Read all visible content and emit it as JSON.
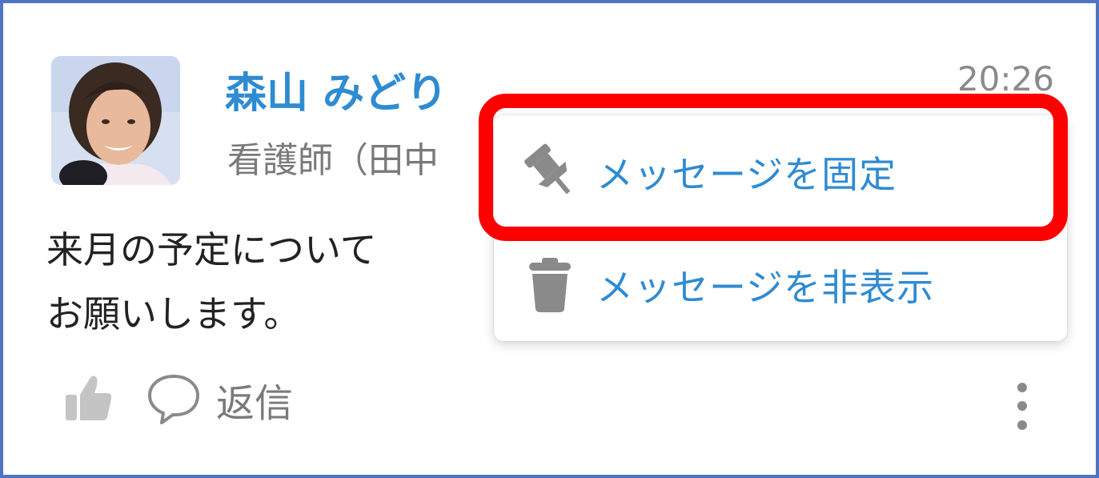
{
  "post": {
    "author_name": "森山 みどり",
    "author_role": "看護師（田中",
    "time": "20:26",
    "message_lines": [
      "来月の予定について",
      "お願いします。"
    ]
  },
  "actions": {
    "like_icon": "thumbs-up-icon",
    "reply_icon": "speech-bubble-icon",
    "reply_label": "返信",
    "more_icon": "vertical-ellipsis-icon"
  },
  "context_menu": {
    "items": [
      {
        "label": "メッセージを固定",
        "icon": "pin-icon"
      },
      {
        "label": "メッセージを非表示",
        "icon": "trash-icon"
      }
    ]
  },
  "colors": {
    "accent": "#2f8bd2",
    "frame_border": "#4f74c6",
    "highlight": "#ff0000",
    "icon_gray": "#8a8a8a"
  }
}
